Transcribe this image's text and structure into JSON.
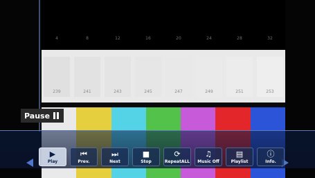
{
  "status": {
    "label": "Pause",
    "icon": "pause-icon"
  },
  "test_pattern": {
    "black_levels": [
      "4",
      "8",
      "12",
      "16",
      "20",
      "24",
      "28",
      "32"
    ],
    "white_levels": [
      "239",
      "241",
      "243",
      "245",
      "247",
      "249",
      "251",
      "253"
    ],
    "color_bars": [
      "#e9e9e9",
      "#e5cf3f",
      "#55d3e6",
      "#53c24b",
      "#c75ad8",
      "#e3262a",
      "#2b54d8"
    ]
  },
  "controls": [
    {
      "label": "Play",
      "icon": "play-icon",
      "glyph": "▶",
      "active": true
    },
    {
      "label": "Prev.",
      "icon": "previous-icon",
      "glyph": "⏮"
    },
    {
      "label": "Next",
      "icon": "next-icon",
      "glyph": "⏭"
    },
    {
      "label": "Stop",
      "icon": "stop-icon",
      "glyph": "■"
    },
    {
      "label": "RepeatALL",
      "icon": "repeat-icon",
      "glyph": "⟳"
    },
    {
      "label": "Music Off",
      "icon": "music-icon",
      "glyph": "♫"
    },
    {
      "label": "Playlist",
      "icon": "playlist-icon",
      "glyph": "▤"
    },
    {
      "label": "Info.",
      "icon": "info-icon",
      "glyph": "ⓘ"
    }
  ],
  "colors": {
    "accent": "#4f76c8",
    "bar_bg": "#19305a"
  }
}
